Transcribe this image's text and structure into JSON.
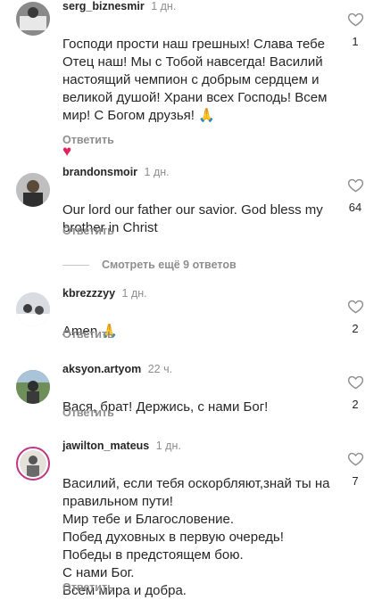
{
  "comments": [
    {
      "username": "serg_biznesmir",
      "time": "1 дн.",
      "text": "Господи прости наш грешных! Слава тебе Отец наш! Мы с Тобой навсегда! Василий настоящий чемпион с добрым сердцем и великой душой! Храни всех Господь! Всем мир! С Богом друзья! 🙏",
      "extra": "♥",
      "reply": "Ответить",
      "likes": "1"
    },
    {
      "username": "brandonsmoir",
      "time": "1 дн.",
      "text": "Our lord our father our savior. God bless my brother in Christ",
      "reply": "Ответить",
      "likes": "64"
    },
    {
      "username": "kbrezzzyy",
      "time": "1 дн.",
      "text": "Amen 🙏",
      "reply": "Ответить",
      "likes": "2"
    },
    {
      "username": "aksyon.artyom",
      "time": "22 ч.",
      "text": "Вася, брат! Держись, с нами Бог!",
      "reply": "Ответить",
      "likes": "2"
    },
    {
      "username": "jawilton_mateus",
      "time": "1 дн.",
      "text": "Василий, если тебя оскорбляют,знай ты на правильном пути!\nМир тебе и Благословение.\nПобед духовных в первую очередь!\nПобеды в предстоящем бою.\nС нами Бог.\nВсем мира и добра.",
      "reply": "Ответить",
      "likes": "7"
    }
  ],
  "more_replies": "Смотреть ещё 9 ответов",
  "colors": {
    "text": "#262626",
    "muted": "#8e8e8e",
    "heart": "#e0245e",
    "story_ring": "#c13584"
  },
  "icons": {
    "like": "heart-outline-icon"
  }
}
